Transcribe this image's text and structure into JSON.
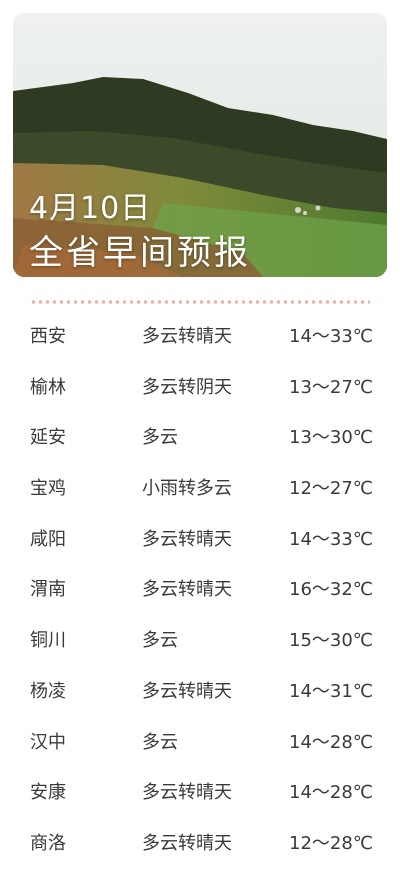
{
  "header": {
    "date": "4月10日",
    "title": "全省早间预报"
  },
  "forecast": [
    {
      "city": "西安",
      "weather": "多云转晴天",
      "temp": "14～33℃"
    },
    {
      "city": "榆林",
      "weather": "多云转阴天",
      "temp": "13～27℃"
    },
    {
      "city": "延安",
      "weather": "多云",
      "temp": "13～30℃"
    },
    {
      "city": "宝鸡",
      "weather": "小雨转多云",
      "temp": "12～27℃"
    },
    {
      "city": "咸阳",
      "weather": "多云转晴天",
      "temp": "14～33℃"
    },
    {
      "city": "渭南",
      "weather": "多云转晴天",
      "temp": "16～32℃"
    },
    {
      "city": "铜川",
      "weather": "多云",
      "temp": "15～30℃"
    },
    {
      "city": "杨凌",
      "weather": "多云转晴天",
      "temp": "14～31℃"
    },
    {
      "city": "汉中",
      "weather": "多云",
      "temp": "14～28℃"
    },
    {
      "city": "安康",
      "weather": "多云转晴天",
      "temp": "14～28℃"
    },
    {
      "city": "商洛",
      "weather": "多云转晴天",
      "temp": "12～28℃"
    }
  ],
  "colors": {
    "text": "#3a3a3a",
    "divider_dots": "#e7b4ad",
    "banner_text": "#ffffff"
  }
}
